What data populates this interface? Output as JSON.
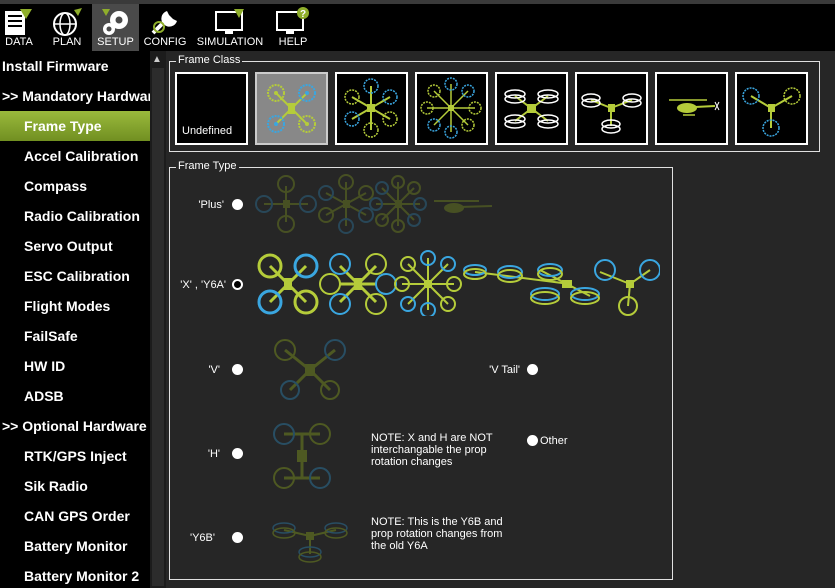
{
  "nav": [
    {
      "label": "DATA",
      "icon": "data-icon"
    },
    {
      "label": "PLAN",
      "icon": "plan-icon"
    },
    {
      "label": "SETUP",
      "icon": "setup-icon"
    },
    {
      "label": "CONFIG",
      "icon": "config-icon"
    },
    {
      "label": "SIMULATION",
      "icon": "simulation-icon"
    },
    {
      "label": "HELP",
      "icon": "help-icon"
    }
  ],
  "sidebar": {
    "items": [
      {
        "label": "Install Firmware"
      },
      {
        "label": ">> Mandatory Hardware"
      },
      {
        "label": "Frame Type"
      },
      {
        "label": "Accel Calibration"
      },
      {
        "label": "Compass"
      },
      {
        "label": "Radio Calibration"
      },
      {
        "label": "Servo Output"
      },
      {
        "label": "ESC Calibration"
      },
      {
        "label": "Flight Modes"
      },
      {
        "label": "FailSafe"
      },
      {
        "label": "HW ID"
      },
      {
        "label": "ADSB"
      },
      {
        "label": ">> Optional Hardware"
      },
      {
        "label": "RTK/GPS Inject"
      },
      {
        "label": "Sik Radio"
      },
      {
        "label": "CAN GPS Order"
      },
      {
        "label": "Battery Monitor"
      },
      {
        "label": "Battery Monitor 2"
      }
    ],
    "selected": "Frame Type"
  },
  "frame_class": {
    "title": "Frame Class",
    "undefined_label": "Undefined",
    "selected": "quad"
  },
  "frame_type": {
    "title": "Frame Type",
    "options": {
      "plus": "'Plus'",
      "x": "'X' , 'Y6A'",
      "v": "'V'",
      "vtail": "'V Tail'",
      "h": "'H'",
      "other": "Other",
      "y6b": "'Y6B'"
    },
    "selected": "x",
    "note_h": "NOTE: X and H are NOT interchangable the prop rotation changes",
    "note_y6b": "NOTE: This is the Y6B and prop rotation changes from the old Y6A"
  },
  "colors": {
    "accent": "#8fae2b",
    "motor_green": "#b5cc3a",
    "motor_blue": "#3aa6e0"
  }
}
